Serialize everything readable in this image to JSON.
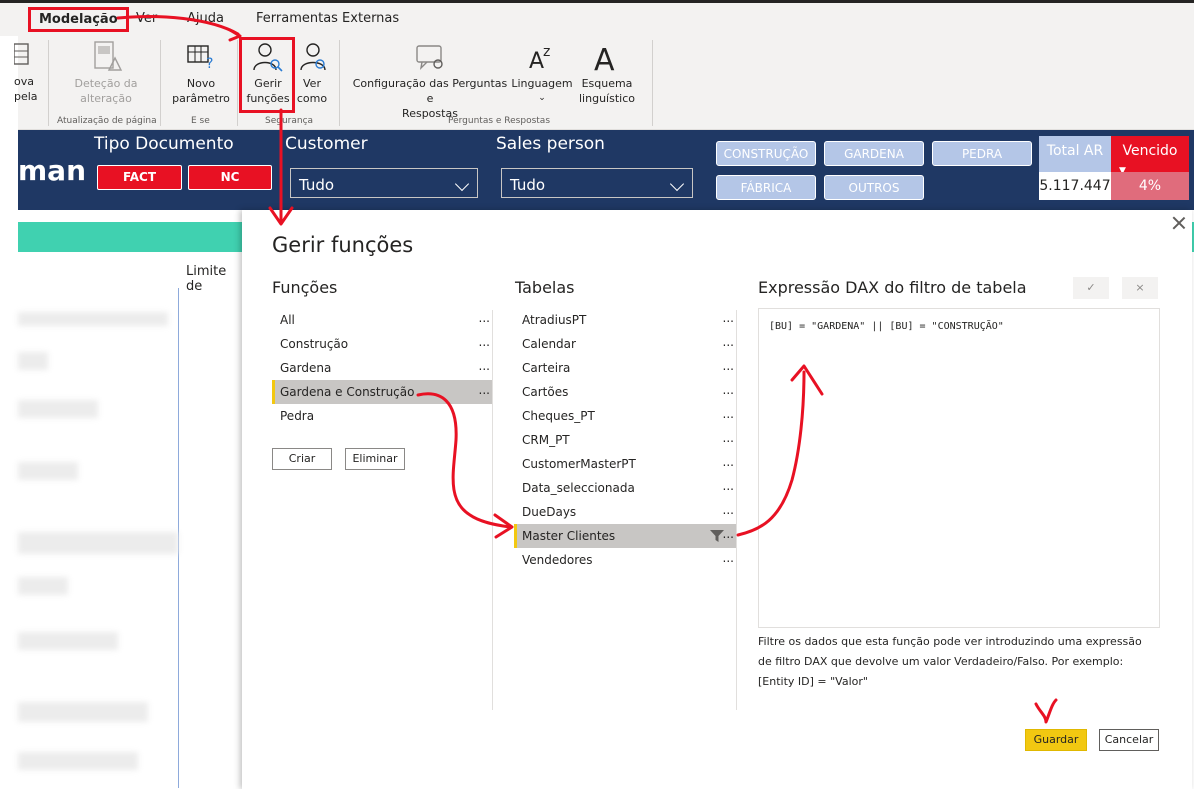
{
  "ribbon_tabs": [
    "Modelação",
    "Ver",
    "Ajuda",
    "Ferramentas Externas"
  ],
  "ribbon": {
    "nova_pagina": "ova\npela",
    "detecao": "Deteção da\nalteração",
    "atualizacao_group": "Atualização de página",
    "novo_parametro": "Novo\nparâmetro",
    "e_se_group": "E se",
    "gerir_funcoes": "Gerir\nfunções",
    "ver_como": "Ver\ncomo",
    "seguranca_group": "Segurança",
    "configuracao": "Configuração das Perguntas e\nRespostas",
    "linguagem": "Linguagem",
    "esquema": "Esquema\nlinguístico",
    "perguntas_group": "Perguntas e Respostas"
  },
  "report": {
    "title": "man",
    "tipo_documento": "Tipo Documento",
    "fact": "FACT",
    "nc": "NC",
    "customer": "Customer",
    "customer_value": "Tudo",
    "sales_person": "Sales person",
    "sales_value": "Tudo",
    "bu_buttons": [
      "CONSTRUÇÃO",
      "GARDENA",
      "PEDRA",
      "FÁBRICA",
      "OUTROS"
    ],
    "total_ar_label": "Total AR",
    "total_ar_value": "5.117.447",
    "vencido_label": "Vencido",
    "vencido_value": "4%",
    "table_header": "Limite de"
  },
  "dialog": {
    "title": "Gerir funções",
    "funcoes_title": "Funções",
    "funcoes": [
      "All",
      "Construção",
      "Gardena",
      "Gardena e Construção",
      "Pedra"
    ],
    "selected_funcao": 3,
    "criar": "Criar",
    "eliminar": "Eliminar",
    "tabelas_title": "Tabelas",
    "tabelas": [
      "AtradiusPT",
      "Calendar",
      "Carteira",
      "Cartões",
      "Cheques_PT",
      "CRM_PT",
      "CustomerMasterPT",
      "Data_seleccionada",
      "DueDays",
      "Master Clientes",
      "Vendedores"
    ],
    "selected_tabela": 9,
    "more": "...",
    "dax_title": "Expressão DAX do filtro de tabela",
    "check": "✓",
    "cancel_x": "×",
    "dax_expression": "[BU] = \"GARDENA\" || [BU] = \"CONSTRUÇÃO\"",
    "hint": "Filtre os dados que esta função pode ver introduzindo uma expressão de filtro DAX que devolve um valor Verdadeiro/Falso. Por exemplo: [Entity ID] = \"Valor\"",
    "guardar": "Guardar",
    "cancelar": "Cancelar"
  },
  "colors": {
    "accent_yellow": "#f2c811",
    "annotation_red": "#e81123",
    "report_navy": "#1f3864",
    "teal": "#40d1b0"
  }
}
